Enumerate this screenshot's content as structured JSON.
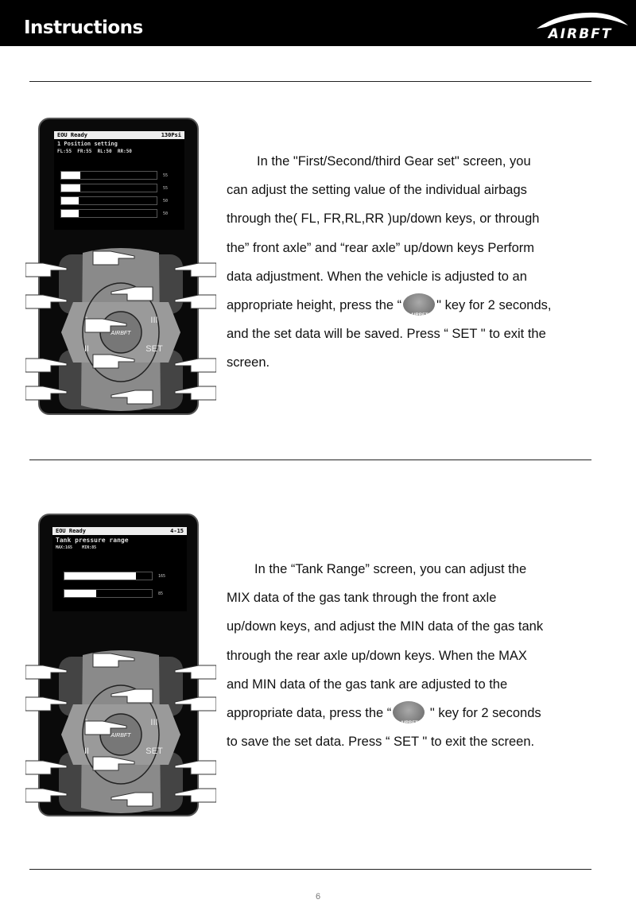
{
  "header": {
    "title": "Instructions",
    "logo_text": "AIRBFT"
  },
  "section1": {
    "screen": {
      "status": "EOU Ready",
      "pressure": "130Psi",
      "heading": "1 Position setting",
      "values_line": "FL:55  FR:55  RL:50  RR:50",
      "bars": [
        {
          "value": "55",
          "fraction": 0.2
        },
        {
          "value": "55",
          "fraction": 0.2
        },
        {
          "value": "50",
          "fraction": 0.18
        },
        {
          "value": "50",
          "fraction": 0.18
        }
      ]
    },
    "keys": {
      "key1": "I",
      "key2": "II",
      "key3": "III",
      "set": "SET"
    },
    "lines": [
      "In the \"First/Second/third Gear set\" screen, you",
      "can adjust the setting value of the individual airbags",
      "through the( FL, FR,RL,RR )up/down keys, or through",
      "the” front axle” and “rear axle” up/down keys Perform",
      "data adjustment. When the vehicle is adjusted to an",
      {
        "before": "appropriate height, press the “",
        "after": "\" key for 2 seconds,"
      },
      "and the set data will be saved. Press “ SET \" to exit the",
      "screen."
    ]
  },
  "section2": {
    "screen": {
      "status": "EOU Ready",
      "code": "4-15",
      "heading": "Tank pressure range",
      "values_line": "MAX:165    MIN:85",
      "bars": [
        {
          "value": "165",
          "fraction": 0.82
        },
        {
          "value": "85",
          "fraction": 0.36
        }
      ]
    },
    "keys": {
      "key1": "I",
      "key2": "II",
      "key3": "III",
      "set": "SET"
    },
    "lines": [
      "In the “Tank Range” screen, you can adjust the",
      "MIX data of the gas tank through the front axle",
      "up/down keys, and adjust the MIN data of the gas tank",
      "through the rear axle up/down keys. When the MAX",
      "and MIN data of the gas tank are adjusted to the",
      {
        "before": "appropriate data, press the “",
        "after": " \" key for 2 seconds"
      },
      "to save the set data. Press “ SET \" to exit the screen."
    ]
  },
  "page_number": "6",
  "colors": {
    "header_bg": "#000000",
    "keypad_gray": "#8a8a8a"
  }
}
